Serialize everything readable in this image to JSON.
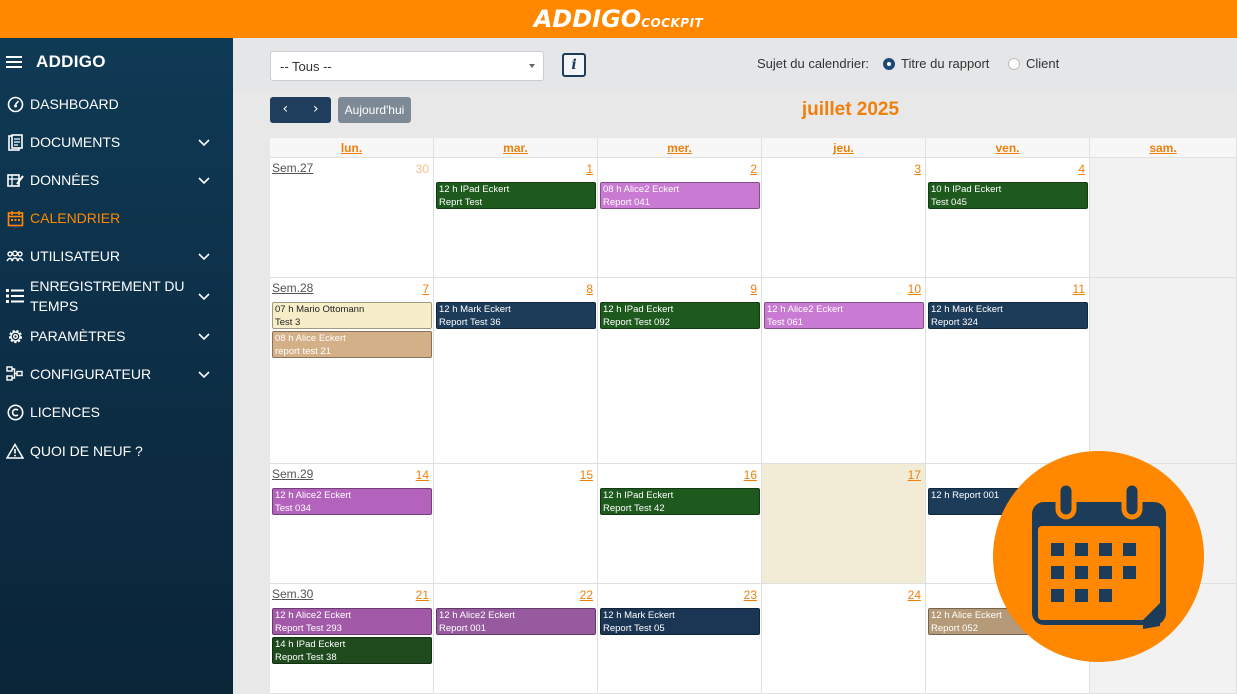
{
  "topbar": {
    "brand": "ADDIGO",
    "brand_sub": "COCKPIT"
  },
  "sidebar": {
    "title": "ADDIGO",
    "items": [
      {
        "label": "DASHBOARD",
        "icon": "dashboard-icon",
        "chevron": false,
        "active": false
      },
      {
        "label": "DOCUMENTS",
        "icon": "document-icon",
        "chevron": true,
        "active": false
      },
      {
        "label": "DONNÉES",
        "icon": "data-edit-icon",
        "chevron": true,
        "active": false
      },
      {
        "label": "CALENDRIER",
        "icon": "calendar-icon",
        "chevron": false,
        "active": true
      },
      {
        "label": "UTILISATEUR",
        "icon": "users-icon",
        "chevron": true,
        "active": false
      },
      {
        "label": "ENREGISTREMENT DU TEMPS",
        "icon": "list-icon",
        "chevron": true,
        "active": false
      },
      {
        "label": "PARAMÈTRES",
        "icon": "gear-icon",
        "chevron": true,
        "active": false
      },
      {
        "label": "CONFIGURATEUR",
        "icon": "configurator-icon",
        "chevron": true,
        "active": false
      },
      {
        "label": "LICENCES",
        "icon": "copyright-icon",
        "chevron": false,
        "active": false
      },
      {
        "label": "QUOI DE NEUF ?",
        "icon": "warning-icon",
        "chevron": false,
        "active": false
      }
    ]
  },
  "filters": {
    "select_value": "-- Tous --",
    "info_label": "i",
    "subject_label": "Sujet du calendrier:",
    "radio_options": [
      {
        "label": "Titre du rapport",
        "selected": true
      },
      {
        "label": "Client",
        "selected": false
      }
    ]
  },
  "toolbar": {
    "prev": "‹",
    "next": "›",
    "today": "Aujourd'hui",
    "month_title": "juillet 2025"
  },
  "calendar": {
    "day_headers": [
      "lun.",
      "mar.",
      "mer.",
      "jeu.",
      "ven.",
      "sam."
    ],
    "weeks": [
      {
        "label": "Sem.27",
        "days": [
          "30",
          "1",
          "2",
          "3",
          "4",
          ""
        ]
      },
      {
        "label": "Sem.28",
        "days": [
          "7",
          "8",
          "9",
          "10",
          "11",
          ""
        ]
      },
      {
        "label": "Sem.29",
        "days": [
          "14",
          "15",
          "16",
          "17",
          "18",
          ""
        ]
      },
      {
        "label": "Sem.30",
        "days": [
          "21",
          "22",
          "23",
          "24",
          "25",
          ""
        ]
      }
    ],
    "events": [
      {
        "week": 0,
        "day": 1,
        "slot": 0,
        "line1": "12 h IPad Eckert",
        "line2": "Reprt Test",
        "color": "#1e5a1e"
      },
      {
        "week": 0,
        "day": 2,
        "slot": 0,
        "line1": "08 h Alice2 Eckert",
        "line2": "Report 041",
        "color": "#c97ad2"
      },
      {
        "week": 0,
        "day": 4,
        "slot": 0,
        "line1": "10 h IPad Eckert",
        "line2": "Test 045",
        "color": "#1e5a1e"
      },
      {
        "week": 1,
        "day": 0,
        "slot": 0,
        "line1": "07 h Mario Ottomann",
        "line2": "Test 3",
        "color": "#f7edc8",
        "text": "#222"
      },
      {
        "week": 1,
        "day": 0,
        "slot": 1,
        "line1": "08 h Alice Eckert",
        "line2": "report test 21",
        "color": "#d4b088"
      },
      {
        "week": 1,
        "day": 1,
        "slot": 0,
        "line1": "12 h Mark Eckert",
        "line2": "Report Test 36",
        "color": "#1d3c5a"
      },
      {
        "week": 1,
        "day": 2,
        "slot": 0,
        "line1": "12 h IPad Eckert",
        "line2": "Report Test 092",
        "color": "#1e5a1e"
      },
      {
        "week": 1,
        "day": 3,
        "slot": 0,
        "line1": "12 h Alice2 Eckert",
        "line2": "Test 061",
        "color": "#c97ad2"
      },
      {
        "week": 1,
        "day": 4,
        "slot": 0,
        "line1": "12 h Mark Eckert",
        "line2": "Report 324",
        "color": "#1d3c5a"
      },
      {
        "week": 2,
        "day": 0,
        "slot": 0,
        "line1": "12 h Alice2 Eckert",
        "line2": "Test 034",
        "color": "#b463bc"
      },
      {
        "week": 2,
        "day": 2,
        "slot": 0,
        "line1": "12 h IPad Eckert",
        "line2": "Report Test 42",
        "color": "#1e5a1e"
      },
      {
        "week": 2,
        "day": 4,
        "slot": 0,
        "line1": "12 h Report 001",
        "line2": "",
        "color": "#1d3c5a"
      },
      {
        "week": 3,
        "day": 0,
        "slot": 0,
        "line1": "12 h Alice2 Eckert",
        "line2": "Report Test 293",
        "color": "#a25aa8"
      },
      {
        "week": 3,
        "day": 0,
        "slot": 1,
        "line1": "14 h IPad Eckert",
        "line2": "Report Test 38",
        "color": "#1e4a1e"
      },
      {
        "week": 3,
        "day": 1,
        "slot": 0,
        "line1": "12 h Alice2 Eckert",
        "line2": "Report 001",
        "color": "#975a9e"
      },
      {
        "week": 3,
        "day": 2,
        "slot": 0,
        "line1": "12 h Mark Eckert",
        "line2": "Report Test 05",
        "color": "#1b3654"
      },
      {
        "week": 3,
        "day": 4,
        "slot": 0,
        "line1": "12 h Alice Eckert",
        "line2": "Report 052",
        "color": "#b49a78"
      }
    ]
  },
  "overlay": {
    "icon": "calendar-icon",
    "color": "#ff8800"
  }
}
